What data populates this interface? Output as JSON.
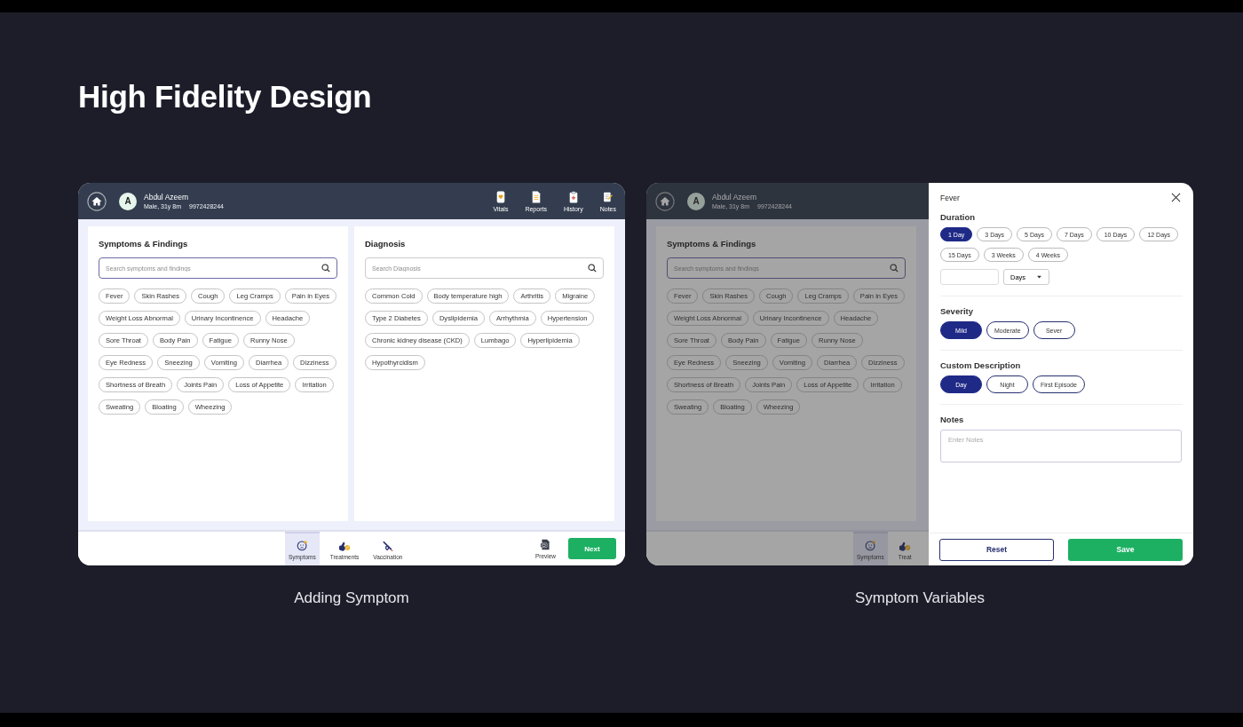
{
  "slide": {
    "title": "High Fidelity Design"
  },
  "screens": [
    {
      "caption": "Adding Symptom",
      "patient": {
        "avatar": "A",
        "name": "Abdul Azeem",
        "details": "Male, 31y 8m",
        "phone": "9972428244"
      },
      "header_actions": [
        {
          "kind": "vitals",
          "label": "Vitals"
        },
        {
          "kind": "reports",
          "label": "Reports"
        },
        {
          "kind": "history",
          "label": "History"
        },
        {
          "kind": "notes",
          "label": "Notes"
        }
      ],
      "panels": [
        {
          "title": "Symptoms & Findings",
          "search": {
            "placeholder": "Search symptoms and findings",
            "focused": true
          },
          "chips": [
            "Fever",
            "Skin Rashes",
            "Cough",
            "Leg Cramps",
            "Pain in Eyes",
            "Weight Loss Abnormal",
            "Urinary Incontinence",
            "Headache",
            "Sore Throat",
            "Body Pain",
            "Fatigue",
            "Runny Nose",
            "Eye Redness",
            "Sneezing",
            "Vomiting",
            "Diarrhea",
            "Dizziness",
            "Shortness of Breath",
            "Joints Pain",
            "Loss of Appetite",
            "Irritation",
            "Sweating",
            "Bloating",
            "Wheezing"
          ]
        },
        {
          "title": "Diagnosis",
          "search": {
            "placeholder": "Search Diagnosis",
            "focused": false
          },
          "chips": [
            "Common Cold",
            "Body temperature high",
            "Arthritis",
            "Migraine",
            "Type 2 Diabetes",
            "Dyslipidemia",
            "Arrhythmia",
            "Hypertension",
            "Chronic kidney disease (CKD)",
            "Lumbago",
            "Hyperlipidemia",
            "Hypothyrcidism"
          ]
        }
      ],
      "nav": [
        {
          "kind": "symptoms",
          "label": "Symptoms",
          "selected": true
        },
        {
          "kind": "treatments",
          "label": "Treatments",
          "selected": false
        },
        {
          "kind": "vaccination",
          "label": "Vaccination",
          "selected": false
        }
      ],
      "preview": {
        "label": "Preview"
      },
      "next": {
        "label": "Next"
      }
    },
    {
      "caption": "Symptom Variables",
      "patient": {
        "avatar": "A",
        "name": "Abdul Azeem",
        "details": "Male, 31y 8m",
        "phone": "9972428244"
      },
      "panels": [
        {
          "title": "Symptoms & Findings",
          "search": {
            "placeholder": "Search symptoms and findings",
            "focused": true
          },
          "chips": [
            "Fever",
            "Skin Rashes",
            "Cough",
            "Leg Cramps",
            "Pain in Eyes",
            "Weight Loss Abnormal",
            "Urinary Incontinence",
            "Headache",
            "Sore Throat",
            "Body Pain",
            "Fatigue",
            "Runny Nose",
            "Eye Redness",
            "Sneezing",
            "Vomiting",
            "Diarrhea",
            "Dizziness",
            "Shortness of Breath",
            "Joints Pain",
            "Loss of Appetite",
            "Irritation",
            "Sweating",
            "Bloating",
            "Wheezing"
          ]
        }
      ],
      "nav": [
        {
          "kind": "symptoms",
          "label": "Symptoms",
          "selected": true
        },
        {
          "kind": "treatments",
          "label": "Treat",
          "selected": false
        }
      ],
      "drawer": {
        "title": "Fever",
        "sections": [
          {
            "kind": "small-chips",
            "title": "Duration",
            "options": [
              {
                "label": "1 Day",
                "selected": true
              },
              {
                "label": "3 Days",
                "selected": false
              },
              {
                "label": "5 Days",
                "selected": false
              },
              {
                "label": "7 Days",
                "selected": false
              },
              {
                "label": "10 Days",
                "selected": false
              },
              {
                "label": "12 Days",
                "selected": false
              },
              {
                "label": "15 Days",
                "selected": false
              },
              {
                "label": "3 Weeks",
                "selected": false
              },
              {
                "label": "4 Weeks",
                "selected": false
              }
            ],
            "unit": "Days"
          },
          {
            "kind": "pills",
            "title": "Severity",
            "options": [
              {
                "label": "Mild",
                "selected": true
              },
              {
                "label": "Moderate",
                "selected": false
              },
              {
                "label": "Sever",
                "selected": false
              }
            ]
          },
          {
            "kind": "pills",
            "title": "Custom Description",
            "options": [
              {
                "label": "Day",
                "selected": true
              },
              {
                "label": "Night",
                "selected": false
              },
              {
                "label": "First Episode",
                "selected": false
              }
            ]
          },
          {
            "kind": "notes",
            "title": "Notes",
            "placeholder": "Enter Notes"
          }
        ],
        "buttons": [
          {
            "kind": "outline",
            "label": "Reset"
          },
          {
            "kind": "primary",
            "label": "Save"
          }
        ]
      }
    }
  ]
}
